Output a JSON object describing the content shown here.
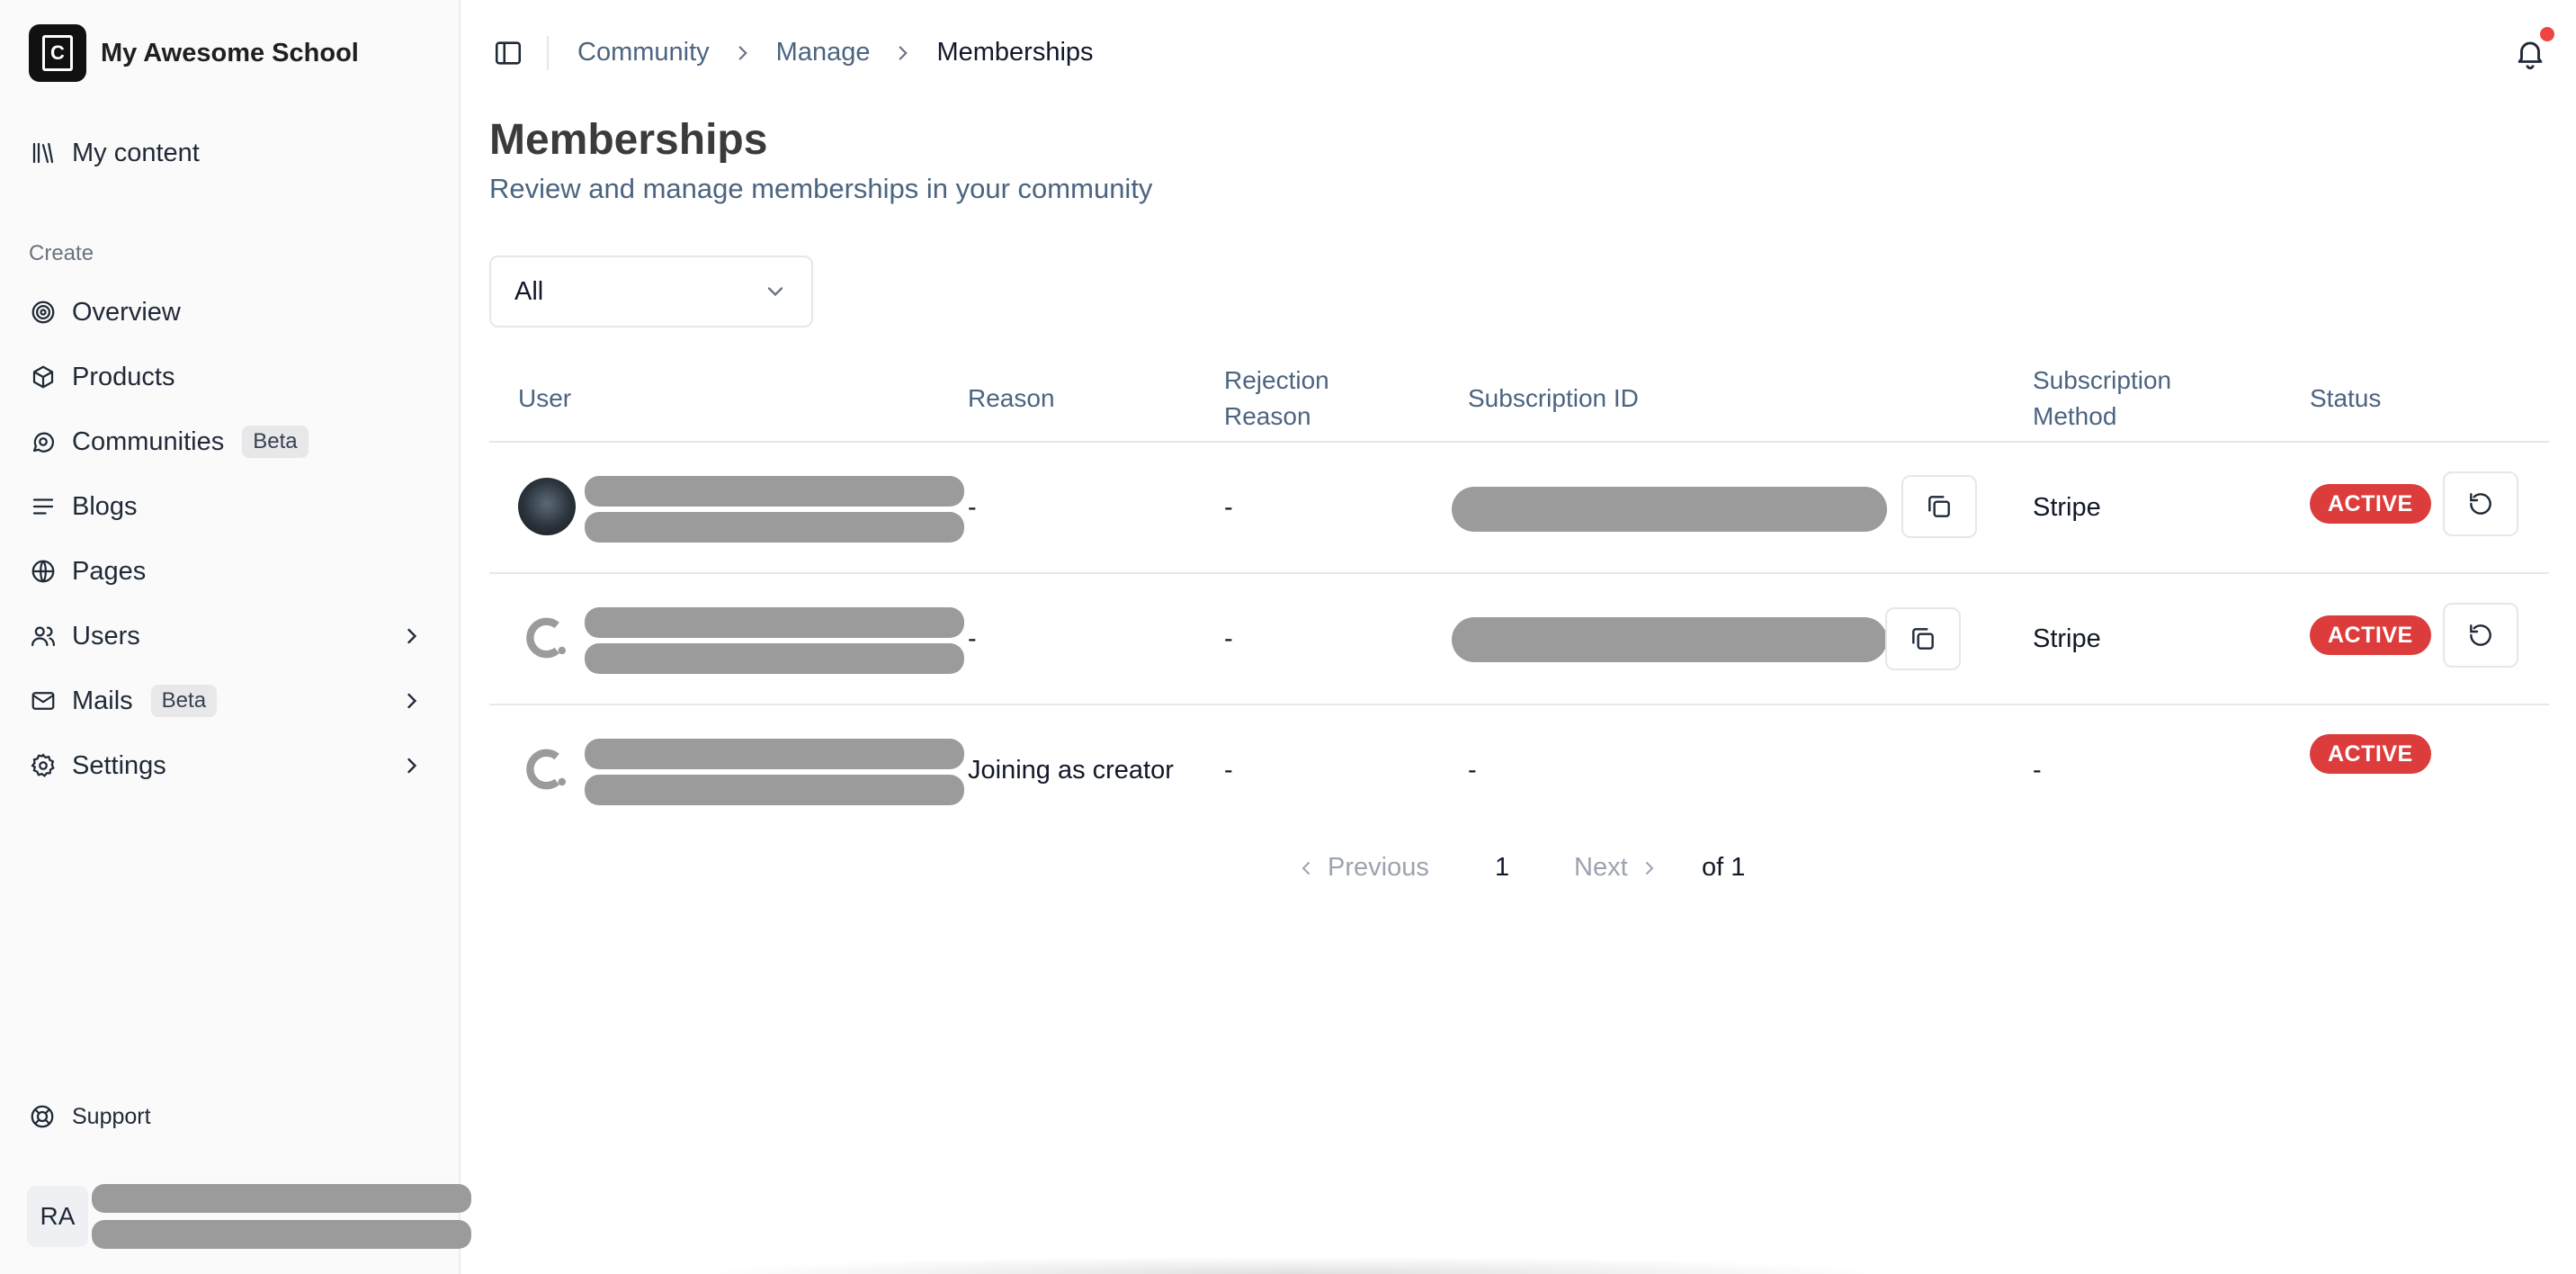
{
  "sidebar": {
    "school_name": "My Awesome School",
    "my_content": "My content",
    "section_label": "Create",
    "items": [
      {
        "label": "Overview",
        "icon": "target-icon"
      },
      {
        "label": "Products",
        "icon": "box-icon"
      },
      {
        "label": "Communities",
        "icon": "chat-icon",
        "badge": "Beta"
      },
      {
        "label": "Blogs",
        "icon": "text-lines-icon"
      },
      {
        "label": "Pages",
        "icon": "globe-icon"
      },
      {
        "label": "Users",
        "icon": "users-icon"
      },
      {
        "label": "Mails",
        "icon": "mail-icon",
        "badge": "Beta"
      },
      {
        "label": "Settings",
        "icon": "gear-icon"
      }
    ],
    "support": "Support",
    "user_initials": "RA"
  },
  "breadcrumb": {
    "items": [
      "Community",
      "Manage",
      "Memberships"
    ]
  },
  "page": {
    "title": "Memberships",
    "subtitle": "Review and manage memberships in your community"
  },
  "filter": {
    "selected": "All"
  },
  "table": {
    "headers": {
      "user": "User",
      "reason": "Reason",
      "rejection_line1": "Rejection",
      "rejection_line2": "Reason",
      "subscription_id": "Subscription ID",
      "method_line1": "Subscription",
      "method_line2": "Method",
      "status": "Status"
    },
    "rows": [
      {
        "reason": "-",
        "rejection_reason": "-",
        "method": "Stripe",
        "status": "ACTIVE"
      },
      {
        "reason": "-",
        "rejection_reason": "-",
        "method": "Stripe",
        "status": "ACTIVE"
      },
      {
        "reason": "Joining as creator",
        "rejection_reason": "-",
        "subscription_id": "-",
        "method": "-",
        "status": "ACTIVE"
      }
    ]
  },
  "pagination": {
    "previous": "Previous",
    "page": "1",
    "next": "Next",
    "of": "of 1"
  },
  "colors": {
    "status_active": "#dc3c3c",
    "muted_text": "#4b6480",
    "notification_dot": "#ef4444"
  }
}
